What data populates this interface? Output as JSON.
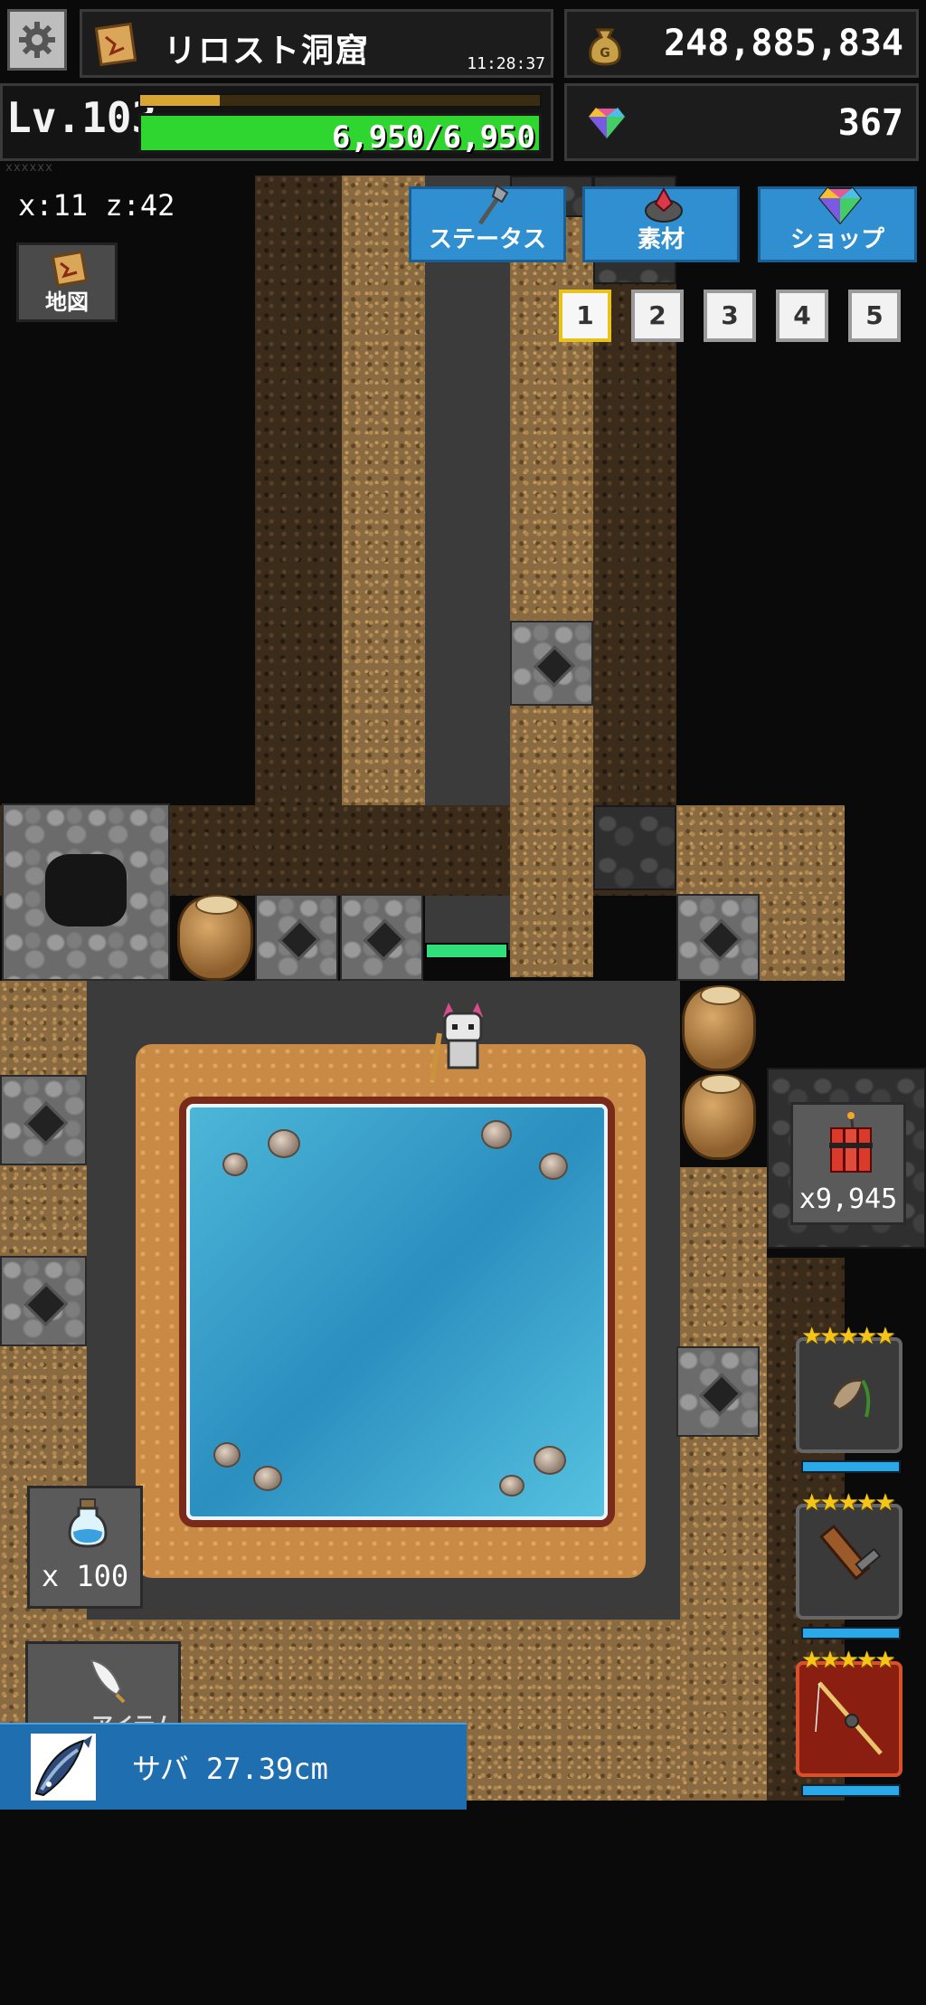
{
  "hud": {
    "location_name": "リロスト洞窟",
    "time": "11:28:37",
    "gold": "248,885,834",
    "level_label": "Lv.103",
    "xp_fraction": 0.2,
    "hp_text": "6,950/6,950",
    "hp_fraction": 1.0,
    "gems": "367",
    "marks": "xxxxxx"
  },
  "player": {
    "coords": "x:11 z:42"
  },
  "menu": {
    "map_label": "地図",
    "status_label": "ステータス",
    "materials_label": "素材",
    "shop_label": "ショップ"
  },
  "slots": [
    "1",
    "2",
    "3",
    "4",
    "5"
  ],
  "items": {
    "potion_count": "x 100",
    "dynamite_count": "x9,945",
    "item_tab_label": "アイテム"
  },
  "equipment": [
    {
      "name": "fishing-bait",
      "stars": "★★★★★",
      "rarity": "normal"
    },
    {
      "name": "wooden-sword",
      "stars": "★★★★★",
      "rarity": "normal"
    },
    {
      "name": "fishing-rod",
      "stars": "★★★★★",
      "rarity": "legendary"
    }
  ],
  "catch": {
    "text": "サバ 27.39cm"
  },
  "colors": {
    "accent": "#2f8fd0",
    "hp": "#2fd62f",
    "xp": "#d8a630",
    "selected_slot": "#e6c21a"
  }
}
